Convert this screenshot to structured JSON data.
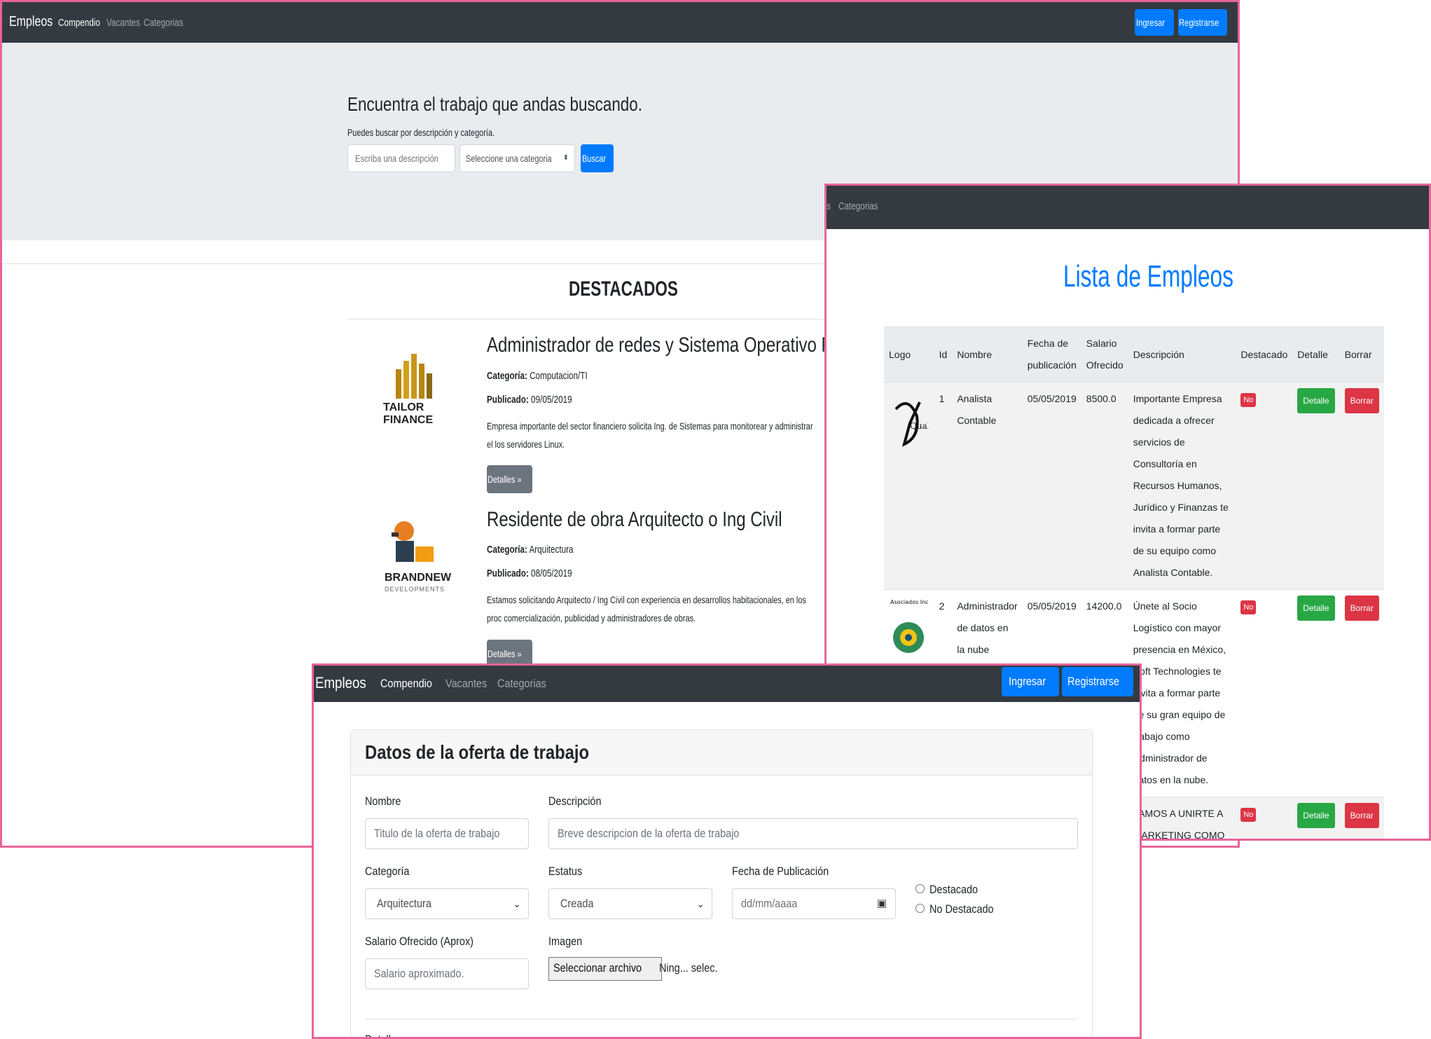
{
  "home": {
    "nav": {
      "brand": "Empleos",
      "links": [
        "Compendio",
        "Vacantes",
        "Categorias"
      ],
      "login": "Ingresar",
      "register": "Registrarse"
    },
    "search": {
      "title": "Encuentra el trabajo que andas buscando.",
      "subtitle": "Puedes buscar por descripción y categoría.",
      "desc_placeholder": "Escriba una descripción",
      "category_select": "Seleccione una categoria",
      "button": "Buscar"
    },
    "featured_heading": "DESTACADOS",
    "jobs": [
      {
        "title": "Administrador de redes y Sistema Operativo Red",
        "category_label": "Categoría:",
        "category": "Computacion/TI",
        "date_label": "Publicado:",
        "date": "09/05/2019",
        "description": "Empresa importante del sector financiero solicita Ing. de Sistemas para monitorear y administrar el los servidores Linux.",
        "button": "Detalles »",
        "logo_text": "TAILOR FINANCE"
      },
      {
        "title": "Residente de obra Arquitecto o Ing Civil",
        "category_label": "Categoría:",
        "category": "Arquitectura",
        "date_label": "Publicado:",
        "date": "08/05/2019",
        "description": "Estamos solicitando Arquitecto / Ing Civil con experiencia en desarrollos habitacionales, en los proc comercialización, publicidad y administradores de obras.",
        "button": "Detalles »",
        "logo_text": "BRANDNEW",
        "logo_sub": "DEVELOPMENTS"
      }
    ]
  },
  "list": {
    "nav_link": "Categorias",
    "nav_fragment": "s",
    "title": "Lista de Empleos",
    "headers": [
      "Logo",
      "Id",
      "Nombre",
      "Fecha de publicación",
      "Salario Ofrecido",
      "Descripción",
      "Destacado",
      "Detalle",
      "Borrar"
    ],
    "rows": [
      {
        "logo": "Quality",
        "id": "1",
        "name": "Analista Contable",
        "date": "05/05/2019",
        "salary": "8500.0",
        "description": "Importante Empresa dedicada a ofrecer servicios de Consultoría en Recursos Humanos, Jurídico y Finanzas te invita a formar parte de su equipo como Analista Contable.",
        "featured": "No",
        "detail": "Detalle",
        "delete": "Borrar"
      },
      {
        "logo": "Asociados Inc.",
        "id": "2",
        "name": "Administrador de datos en la nube",
        "date": "05/05/2019",
        "salary": "14200.0",
        "description": "Únete al Socio Logístico con mayor presencia en México, Soft Technologies te invita a formar parte de su gran equipo de trabajo como Administrador de datos en la nube.",
        "featured": "No",
        "detail": "Detalle",
        "delete": "Borrar"
      },
      {
        "logo": "",
        "id": "",
        "name": "",
        "date": "",
        "salary": "",
        "description": "TAMOS A UNIRTE A MARKETING COMO COORDINADOR O NADORA DE MARKETING. SOMOS PRESA DE INNOVACION EN EL METALMECANICO E ACIONES. EXCELENTE NIDAD DE DESARROLLO Y CION DE CONOCIMIENTOS",
        "featured": "No",
        "detail": "Detalle",
        "delete": "Borrar"
      }
    ]
  },
  "form": {
    "nav": {
      "brand": "Empleos",
      "links": [
        "Compendio",
        "Vacantes",
        "Categorias"
      ],
      "login": "Ingresar",
      "register": "Registrarse"
    },
    "card_title": "Datos de la oferta de trabajo",
    "name_label": "Nombre",
    "name_placeholder": "Titulo de la oferta de trabajo",
    "desc_label": "Descripción",
    "desc_placeholder": "Breve descripcion de la oferta de trabajo",
    "category_label": "Categoría",
    "category_value": "Arquitectura",
    "status_label": "Estatus",
    "status_value": "Creada",
    "date_label": "Fecha de Publicación",
    "date_placeholder": "dd/mm/aaaa",
    "featured_options": [
      "Destacado",
      "No Destacado"
    ],
    "salary_label": "Salario Ofrecido (Aprox)",
    "salary_placeholder": "Salario aproximado.",
    "image_label": "Imagen",
    "file_button": "Seleccionar archivo",
    "file_status": "Ning... selec.",
    "details_label": "Detalles"
  },
  "colors": {
    "navbar": "#343a40",
    "primary": "#007bff",
    "success": "#28a745",
    "danger": "#dc3545",
    "secondary": "#6c757d",
    "frame": "#e8649a"
  }
}
